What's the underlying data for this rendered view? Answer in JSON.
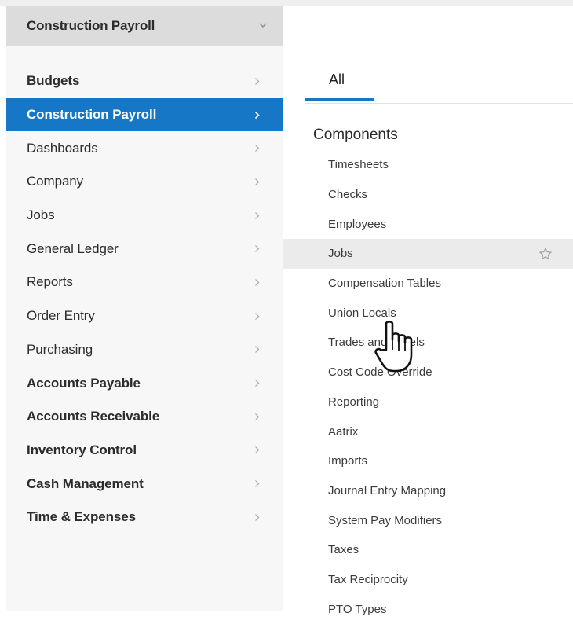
{
  "module_selector": {
    "label": "Construction Payroll",
    "icon": "chevron-down-icon"
  },
  "nav": {
    "items": [
      {
        "label": "Budgets"
      },
      {
        "label": "Construction Payroll",
        "active": true
      },
      {
        "label": "Dashboards"
      },
      {
        "label": "Company"
      },
      {
        "label": "Jobs"
      },
      {
        "label": "General Ledger"
      },
      {
        "label": "Reports"
      },
      {
        "label": "Order Entry"
      },
      {
        "label": "Purchasing"
      },
      {
        "label": "Accounts Payable"
      },
      {
        "label": "Accounts Receivable"
      },
      {
        "label": "Inventory Control"
      },
      {
        "label": "Cash Management"
      },
      {
        "label": "Time & Expenses"
      }
    ],
    "arrow_icon": "chevron-right-icon"
  },
  "tabs": [
    {
      "label": "All",
      "selected": true
    }
  ],
  "section": {
    "title": "Components",
    "items": [
      {
        "label": "Timesheets"
      },
      {
        "label": "Checks"
      },
      {
        "label": "Employees"
      },
      {
        "label": "Jobs",
        "hovered": true,
        "icon": "star-outline-icon"
      },
      {
        "label": "Compensation Tables"
      },
      {
        "label": "Union Locals"
      },
      {
        "label": "Trades and Levels"
      },
      {
        "label": "Cost Code Override"
      },
      {
        "label": "Reporting"
      },
      {
        "label": "Aatrix"
      },
      {
        "label": "Imports"
      },
      {
        "label": "Journal Entry Mapping"
      },
      {
        "label": "System Pay Modifiers"
      },
      {
        "label": "Taxes"
      },
      {
        "label": "Tax Reciprocity"
      },
      {
        "label": "PTO Types"
      }
    ]
  },
  "colors": {
    "accent": "#1677c6",
    "sidebar_bg": "#f7f7f7",
    "selector_bg": "#dcdcdc",
    "hover_bg": "#ebebeb"
  },
  "cursor": "hand-pointer-icon"
}
